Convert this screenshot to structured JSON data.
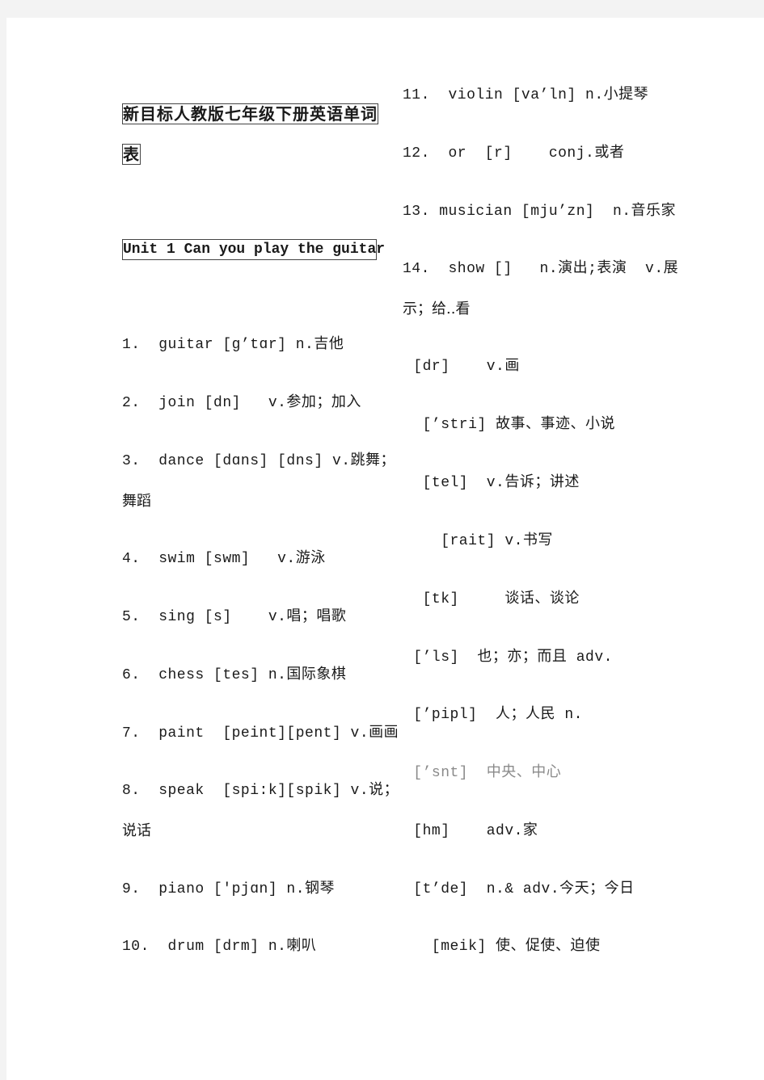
{
  "document": {
    "title_line1": "新目标人教版七年级下册英语单词",
    "title_line2": "表",
    "unit_heading": "Unit 1 Can you play the guitar",
    "left_column": [
      {
        "line": "1.  guitar [g’tɑr] n.吉他"
      },
      {
        "line": "2.  join [dn]   v.参加；加入"
      },
      {
        "line": "3.  dance [dɑns] [dns] v.跳舞；",
        "continuation": "舞蹈"
      },
      {
        "line": "4.  swim [swm]   v.游泳"
      },
      {
        "line": "5.  sing [s]    v.唱；唱歌"
      },
      {
        "line": "6.  chess [tes] n.国际象棋"
      },
      {
        "line": "7.  paint  [peint][pent] v.画画"
      },
      {
        "line": "8.  speak  [spi:k][spik] v.说；",
        "continuation": "说话"
      },
      {
        "line": "9.  piano ['pjɑn] n.钢琴"
      },
      {
        "line": "10.  drum [drm] n.喇叭"
      }
    ],
    "right_column": [
      {
        "line": "11.  violin [va’ln] n.小提琴"
      },
      {
        "line": "12.  or  [r]    conj.或者"
      },
      {
        "line": "13. musician [mju’zn]  n.音乐家"
      },
      {
        "line": "14.  show []   n.演出;表演  v.展",
        "continuation": "示；给..看"
      },
      {
        "line": " [dr]    v.画"
      },
      {
        "line": "  [’stri] 故事、事迹、小说"
      },
      {
        "line": "  [tel]  v.告诉；讲述"
      },
      {
        "line": "    [rait] v.书写"
      },
      {
        "line": "  [tk]     谈话、谈论"
      },
      {
        "line": " [’ls]  也；亦；而且 adv."
      },
      {
        "line": " [’pipl]  人；人民 n."
      },
      {
        "line": " [’snt]  中央、中心",
        "muted": true
      },
      {
        "line": " [hm]    adv.家"
      },
      {
        "line": " [t’de]  n.& adv.今天；今日"
      },
      {
        "line": "   [meik] 使、促使、迫使"
      }
    ]
  },
  "colors": {
    "background": "#f3f3f3",
    "page": "#ffffff",
    "text": "#1a1a1a",
    "muted_text": "#8a8a8a",
    "box_border": "#444444"
  }
}
